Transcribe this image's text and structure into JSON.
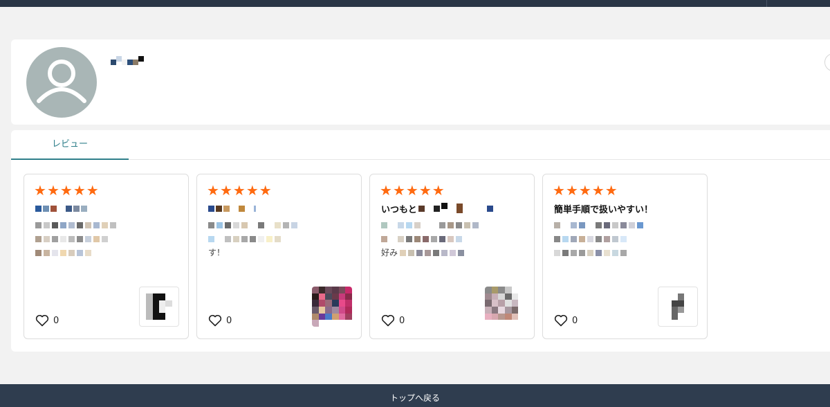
{
  "profile": {
    "username_visible": "",
    "avatar_icon": "user-silhouette-icon"
  },
  "tabs": [
    {
      "label": "レビュー",
      "active": true
    }
  ],
  "reviews": [
    {
      "rating": 5,
      "title_visible": "",
      "body_visible": [
        "",
        "",
        ""
      ],
      "likes": "0"
    },
    {
      "rating": 5,
      "title_visible": "",
      "body_visible": [
        "",
        "",
        "す！"
      ],
      "likes": "0"
    },
    {
      "rating": 5,
      "title_visible": "いつもと",
      "body_visible": [
        "",
        "",
        "好み"
      ],
      "likes": "0"
    },
    {
      "rating": 5,
      "title_visible": "簡単手順で扱いやすい！",
      "body_visible": [
        "",
        "",
        ""
      ],
      "likes": "0"
    }
  ],
  "footer": {
    "back_to_top_label": "トップへ戻る"
  },
  "colors": {
    "topbar": "#2a3646",
    "footer": "#2f3d4f",
    "accent_tab": "#2f7f8a",
    "star": "#ff6a10",
    "avatar_bg": "#a9b6b6"
  }
}
